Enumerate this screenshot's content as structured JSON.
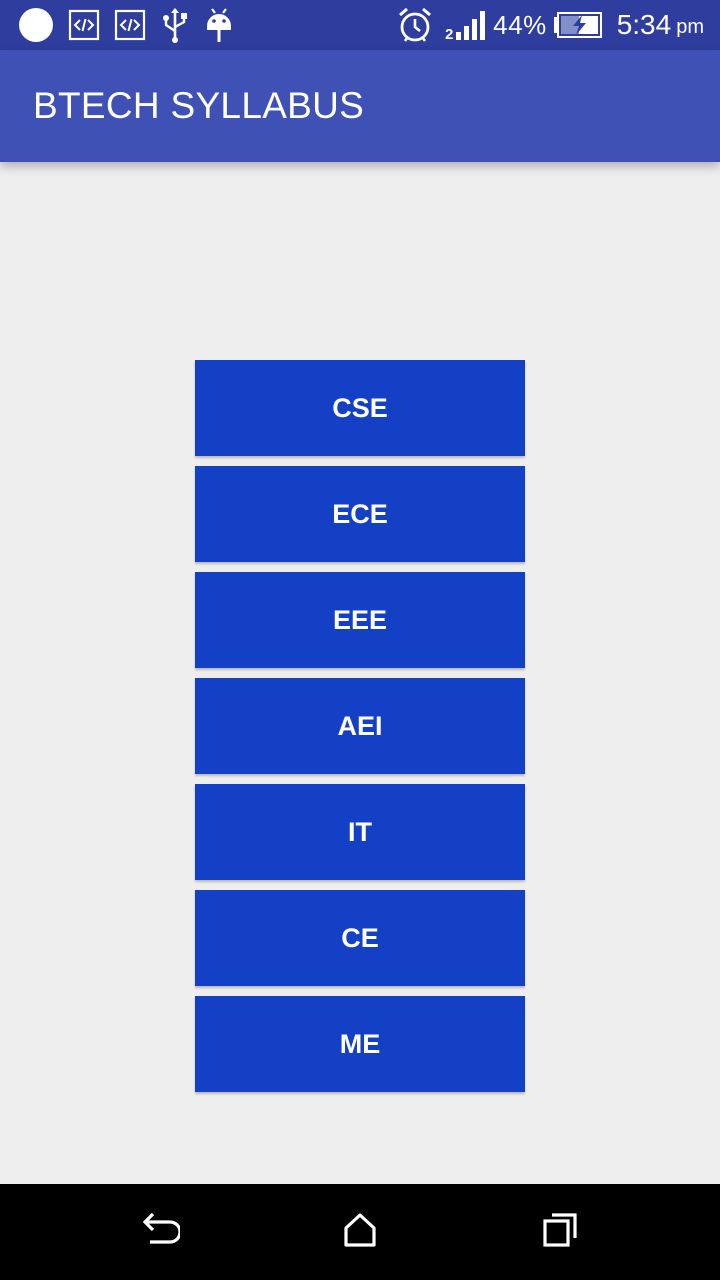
{
  "status_bar": {
    "icons_left": [
      "notification-dot-icon",
      "code-icon",
      "code-icon",
      "usb-icon",
      "android-debug-icon"
    ],
    "icons_right": [
      "alarm-icon",
      "signal-icon",
      "battery-charging-icon"
    ],
    "battery_percent": "44%",
    "time": "5:34",
    "time_suffix": "pm"
  },
  "app_bar": {
    "title": "BTECH SYLLABUS"
  },
  "branches": [
    "CSE",
    "ECE",
    "EEE",
    "AEI",
    "IT",
    "CE",
    "ME"
  ],
  "nav_bar": {
    "icons": [
      "back-icon",
      "home-icon",
      "recents-icon"
    ]
  },
  "colors": {
    "status_bar": "#2f3e9e",
    "app_bar": "#3f51b5",
    "button": "#1440c5",
    "background": "#eeeeee"
  }
}
